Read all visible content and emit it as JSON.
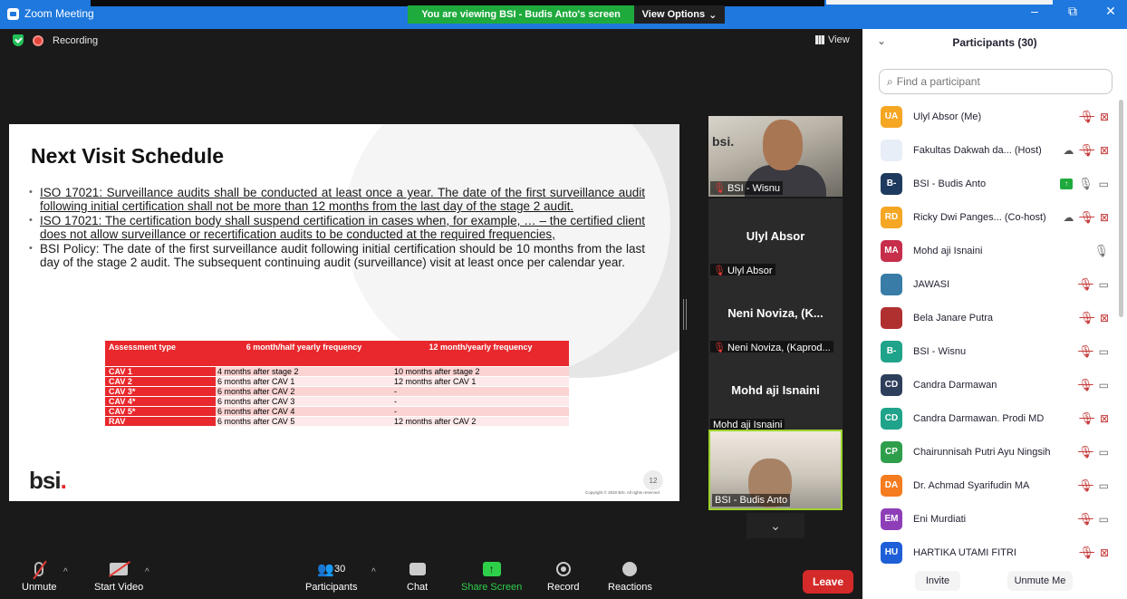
{
  "titlebar": {
    "app": "Zoom Meeting",
    "viewing": "You are viewing BSI - Budis Anto's screen",
    "view_options": "View Options",
    "view_options_caret": "⌄",
    "controls": {
      "minimize": "–",
      "restore": "⧉",
      "close": "✕"
    }
  },
  "status": {
    "recording": "Recording",
    "view": "View"
  },
  "slide": {
    "title": "Next Visit Schedule",
    "bullets": [
      "ISO 17021: Surveillance audits shall be conducted at least once a year. The date of the first surveillance audit following initial certification shall not be more than 12 months from the last day of the stage 2 audit.",
      "ISO 17021: The certification body shall suspend certification in cases when, for example, … – the certified client does not allow surveillance or recertification audits to be conducted at the required frequencies,",
      "BSI Policy: The date of the first surveillance audit following initial certification should be 10 months from the last day of the stage 2 audit. The subsequent continuing audit (surveillance) visit at least once per calendar year."
    ],
    "table": {
      "headers": [
        "Assessment type",
        "6 month/half yearly frequency",
        "12 month/yearly frequency"
      ],
      "rows": [
        [
          "CAV 1",
          "4 months after stage 2",
          "10 months after stage 2"
        ],
        [
          "CAV 2",
          "6 months after CAV 1",
          "12 months after CAV 1"
        ],
        [
          "CAV 3*",
          "6 months after CAV 2",
          "-"
        ],
        [
          "CAV 4*",
          "6 months after CAV 3",
          "-"
        ],
        [
          "CAV 5*",
          "6 months after CAV 4",
          "-"
        ],
        [
          "RAV",
          "6 months after CAV 5",
          "12 months after CAV 2"
        ]
      ]
    },
    "logo": "bsi",
    "logo_dot": ".",
    "page": "12",
    "copyright": "Copyright © 2020 BSI. All rights reserved"
  },
  "tiles": [
    {
      "label": "BSI - Wisnu",
      "sign": "bsi."
    },
    {
      "name": "Ulyl Absor",
      "label": "Ulyl Absor"
    },
    {
      "name": "Neni Noviza, (K...",
      "label": "Neni Noviza, (Kaprod..."
    },
    {
      "name": "Mohd aji Isnaini",
      "label": "Mohd aji Isnaini"
    },
    {
      "label": "BSI - Budis Anto"
    }
  ],
  "toolbar": {
    "unmute": "Unmute",
    "start_video": "Start Video",
    "participants": "Participants",
    "participants_count": "30",
    "chat": "Chat",
    "share": "Share Screen",
    "record": "Record",
    "reactions": "Reactions",
    "leave": "Leave",
    "caret": "^",
    "share_arrow": "↑",
    "scroll_down": "⌄"
  },
  "panel": {
    "title": "Participants (30)",
    "collapse": "⌄",
    "search_placeholder": "Find a participant",
    "search_icon": "⌕",
    "people": [
      {
        "initials": "UA",
        "color": "#f5a623",
        "name": "Ulyl Absor (Me)",
        "mic": "muted",
        "video": "off"
      },
      {
        "initials": "",
        "color": "#e8eef8",
        "name": "Fakultas Dakwah da... (Host)",
        "mic": "muted",
        "video": "off",
        "cloud": true
      },
      {
        "initials": "B-",
        "color": "#1f3a5f",
        "name": "BSI - Budis Anto",
        "mic": "on",
        "video": "on",
        "share": true
      },
      {
        "initials": "RD",
        "color": "#f5a623",
        "name": "Ricky Dwi Panges... (Co-host)",
        "mic": "muted",
        "video": "off",
        "cloud": true
      },
      {
        "initials": "MA",
        "color": "#c62e4a",
        "name": "Mohd aji Isnaini",
        "mic": "on"
      },
      {
        "initials": "",
        "color": "#3a7ca8",
        "name": "JAWASI",
        "mic": "muted",
        "video": "on"
      },
      {
        "initials": "",
        "color": "#b03030",
        "name": "Bela Janare Putra",
        "mic": "muted",
        "video": "off"
      },
      {
        "initials": "B-",
        "color": "#1fa38a",
        "name": "BSI - Wisnu",
        "mic": "muted",
        "video": "on"
      },
      {
        "initials": "CD",
        "color": "#2e3f5c",
        "name": "Candra Darmawan",
        "mic": "muted",
        "video": "on"
      },
      {
        "initials": "CD",
        "color": "#1fa38a",
        "name": "Candra Darmawan. Prodi MD",
        "mic": "muted",
        "video": "off"
      },
      {
        "initials": "CP",
        "color": "#2e9e4a",
        "name": "Chairunnisah Putri Ayu Ningsih",
        "mic": "muted",
        "video": "on"
      },
      {
        "initials": "DA",
        "color": "#f57c1f",
        "name": "Dr. Achmad Syarifudin MA",
        "mic": "muted",
        "video": "on"
      },
      {
        "initials": "EM",
        "color": "#8e3fb8",
        "name": "Eni Murdiati",
        "mic": "muted",
        "video": "on"
      },
      {
        "initials": "HU",
        "color": "#1e5fd8",
        "name": "HARTIKA UTAMI FITRI",
        "mic": "muted",
        "video": "off"
      }
    ],
    "invite": "Invite",
    "unmute_me": "Unmute Me"
  },
  "icons": {
    "mic": "microphone-icon",
    "video": "video-camera-icon",
    "share": "share-screen-icon",
    "cloud": "cloud-record-icon",
    "muted_glyph": "🎙̸",
    "mic_glyph": "🎙",
    "video_glyph": "▭◁",
    "video_off_glyph": "⊠",
    "cloud_glyph": "☁"
  }
}
